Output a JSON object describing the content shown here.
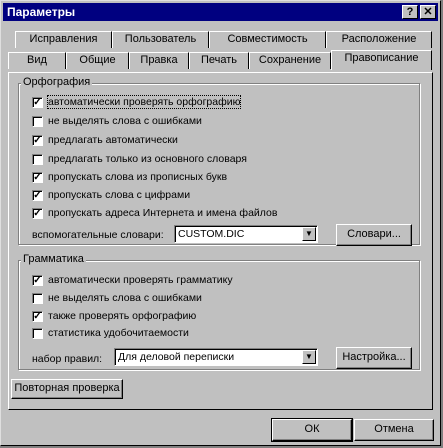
{
  "window": {
    "title": "Параметры",
    "help_glyph": "?",
    "close_glyph": "✕"
  },
  "tabs_back": [
    "Исправления",
    "Пользователь",
    "Совместимость",
    "Расположение"
  ],
  "tabs_front": [
    "Вид",
    "Общие",
    "Правка",
    "Печать",
    "Сохранение",
    "Правописание"
  ],
  "spelling": {
    "group_label": "Орфография",
    "options": [
      {
        "label": "автоматически проверять орфографию",
        "checked": true
      },
      {
        "label": "не выделять слова с ошибками",
        "checked": false
      },
      {
        "label": "предлагать автоматически",
        "checked": true
      },
      {
        "label": "предлагать только из основного словаря",
        "checked": false
      },
      {
        "label": "пропускать слова из прописных букв",
        "checked": true
      },
      {
        "label": "пропускать слова с цифрами",
        "checked": true
      },
      {
        "label": "пропускать адреса Интернета и имена файлов",
        "checked": true
      }
    ],
    "dict_label": "вспомогательные словари:",
    "dict_value": "CUSTOM.DIC",
    "dict_button": "Словари..."
  },
  "grammar": {
    "group_label": "Грамматика",
    "options": [
      {
        "label": "автоматически проверять грамматику",
        "checked": true
      },
      {
        "label": "не выделять слова с ошибками",
        "checked": false
      },
      {
        "label": "также проверять орфографию",
        "checked": true
      },
      {
        "label": "статистика удобочитаемости",
        "checked": false
      }
    ],
    "rules_label": "набор правил:",
    "rules_value": "Для деловой переписки",
    "settings_button": "Настройка..."
  },
  "recheck_button": "Повторная проверка",
  "ok_button": "ОК",
  "cancel_button": "Отмена",
  "check_glyph": "✓"
}
